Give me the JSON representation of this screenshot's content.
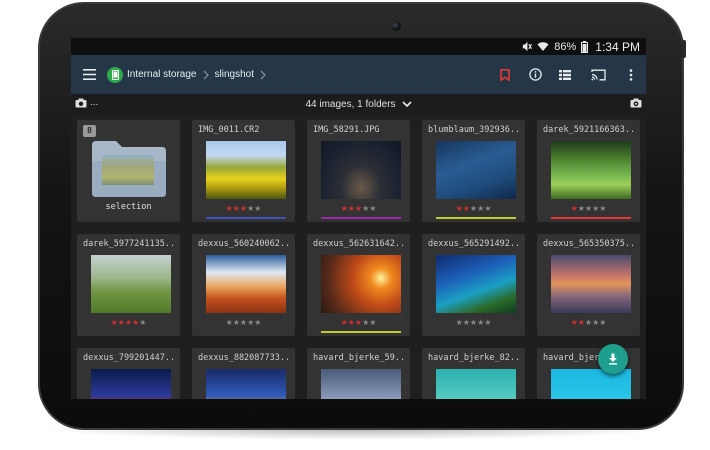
{
  "statusbar": {
    "battery": "86%",
    "time": "1:34 PM",
    "icons": [
      "mute-icon",
      "wifi-icon",
      "battery-icon"
    ]
  },
  "appbar": {
    "menu_icon": "hamburger-menu-icon",
    "storage_icon": "phone-icon",
    "breadcrumb": [
      "Internal storage",
      "slingshot"
    ],
    "actions": [
      "bookmark-icon",
      "info-icon",
      "list-view-icon",
      "cast-icon",
      "more-vert-icon"
    ],
    "bookmark_color": "#e53935"
  },
  "infobar": {
    "left_ellipsis": "...",
    "summary": "44 images, 1 folders",
    "left_icon": "camera-icon",
    "right_icon": "eye-camera-icon",
    "dropdown_icon": "chevron-down-icon"
  },
  "folder": {
    "badge": "8",
    "label": "selection"
  },
  "images": [
    {
      "name": "IMG_0011.CR2",
      "rating": 3,
      "label_color": "#3f51b5"
    },
    {
      "name": "IMG_58291.JPG",
      "rating": 3,
      "label_color": "#9c27b0"
    },
    {
      "name": "blumblaum_392936...",
      "rating": 2,
      "label_color": "#c0ca33"
    },
    {
      "name": "darek_5921166363...",
      "rating": 1,
      "label_color": "#e53935"
    },
    {
      "name": "darek_5977241135...",
      "rating": 4,
      "label_color": ""
    },
    {
      "name": "dexxus_560240062...",
      "rating": 0,
      "label_color": ""
    },
    {
      "name": "dexxus_562631642...",
      "rating": 3,
      "label_color": "#c0ca33"
    },
    {
      "name": "dexxus_565291492...",
      "rating": 0,
      "label_color": ""
    },
    {
      "name": "dexxus_565350375...",
      "rating": 2,
      "label_color": ""
    },
    {
      "name": "dexxus_799201447...",
      "rating": 0,
      "label_color": ""
    },
    {
      "name": "dexxus_882087733...",
      "rating": 0,
      "label_color": ""
    },
    {
      "name": "havard_bjerke_59...",
      "rating": 0,
      "label_color": ""
    },
    {
      "name": "havard_bjerke_82...",
      "rating": 0,
      "label_color": ""
    },
    {
      "name": "havard_bjerke_",
      "rating": 0,
      "label_color": ""
    }
  ],
  "fab": {
    "icon": "download-icon",
    "color": "#1e9e8c"
  }
}
